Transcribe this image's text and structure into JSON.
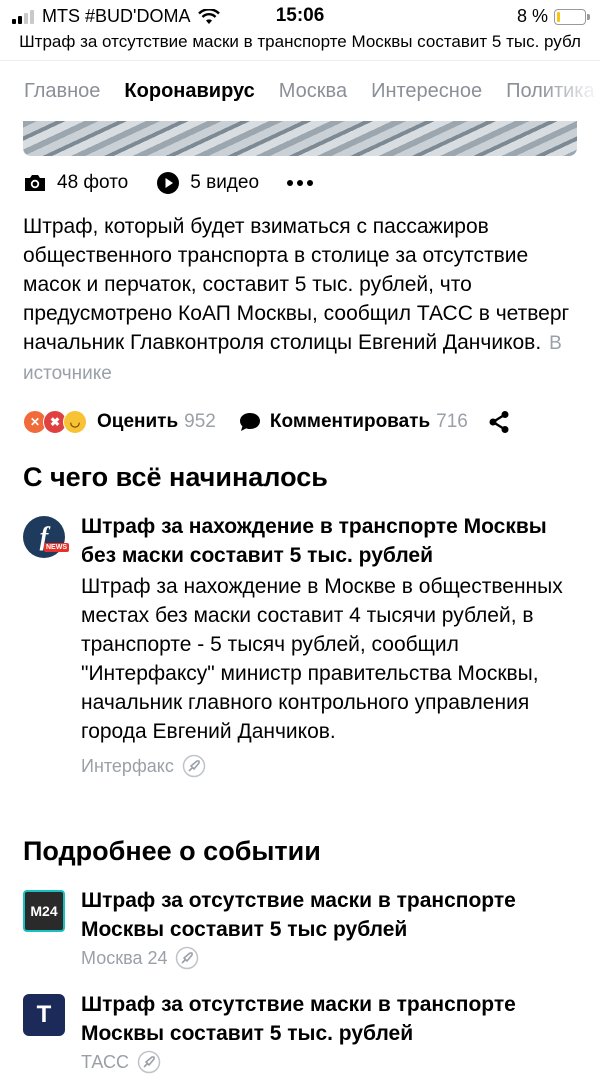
{
  "status_bar": {
    "carrier": "MTS #BUD'DOMA",
    "time": "15:06",
    "battery": "8 %",
    "battery_level": 0.08
  },
  "page_title": "Штраф за отсутствие маски в транспорте Москвы составит 5 тыс. рубл",
  "tabs": [
    {
      "label": "Главное",
      "active": false
    },
    {
      "label": "Коронавирус",
      "active": true
    },
    {
      "label": "Москва",
      "active": false
    },
    {
      "label": "Интересное",
      "active": false
    },
    {
      "label": "Политика",
      "active": false
    }
  ],
  "media": {
    "photos": "48 фото",
    "videos": "5 видео",
    "icons": [
      "camera-icon",
      "play-icon",
      "more-icon"
    ]
  },
  "lead": {
    "text": "Штраф, который будет взиматься с пассажиров общественного транспорта в столице за отсутствие масок и перчаток, составит 5 тыс. рублей, что предусмотрено КоАП Москвы, сообщил ТАСС в четверг начальник Главконтроля столицы Евгений Данчиков.",
    "source_link": "В источнике"
  },
  "actions": {
    "rate_label": "Оценить",
    "rate_count": "952",
    "comment_label": "Комментировать",
    "comment_count": "716"
  },
  "section_origin": {
    "title": "С чего всё начиналось",
    "story": {
      "logo_text": "f",
      "logo_tag": "NEWS",
      "title": "Штраф за нахождение в транспорте Москвы без маски составит 5 тыс. рублей",
      "text": "Штраф за нахождение в Москве в общественных местах без маски составит 4 тысячи рублей, в транспорте - 5 тысяч рублей, сообщил \"Интерфаксу\" министр правительства Москвы, начальник главного контрольного управления города Евгений Данчиков.",
      "source": "Интерфакс"
    }
  },
  "section_more": {
    "title": "Подробнее о событии",
    "stories": [
      {
        "logo_text": "M24",
        "title": "Штраф за отсутствие маски в транспорте Москвы составит 5 тыс рублей",
        "source": "Москва 24"
      },
      {
        "logo_text": "T",
        "title": "Штраф за отсутствие маски в транспорте Москвы составит 5 тыс. рублей",
        "source": "ТАСС"
      }
    ]
  },
  "colors": {
    "muted": "#9aa0a8",
    "tab_inactive": "#8a8f98",
    "battery": "#f5c518"
  }
}
